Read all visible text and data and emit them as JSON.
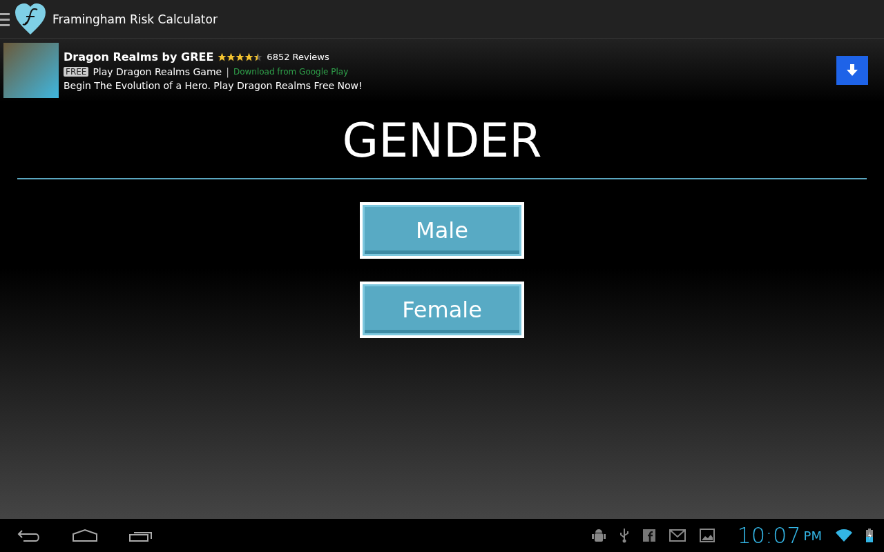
{
  "app_bar": {
    "title": "Framingham Risk Calculator"
  },
  "ad": {
    "title": "Dragon Realms by GREE",
    "stars": 4.5,
    "reviews": "6852 Reviews",
    "badge": "FREE",
    "subtitle": "Play Dragon Realms Game",
    "separator": "|",
    "link": "Download from Google Play",
    "description": "Begin The Evolution of a Hero. Play Dragon Realms Free Now!"
  },
  "heading": "GENDER",
  "buttons": [
    {
      "label": "Male"
    },
    {
      "label": "Female"
    }
  ],
  "status_bar": {
    "time": "10:07",
    "ampm": "PM"
  }
}
